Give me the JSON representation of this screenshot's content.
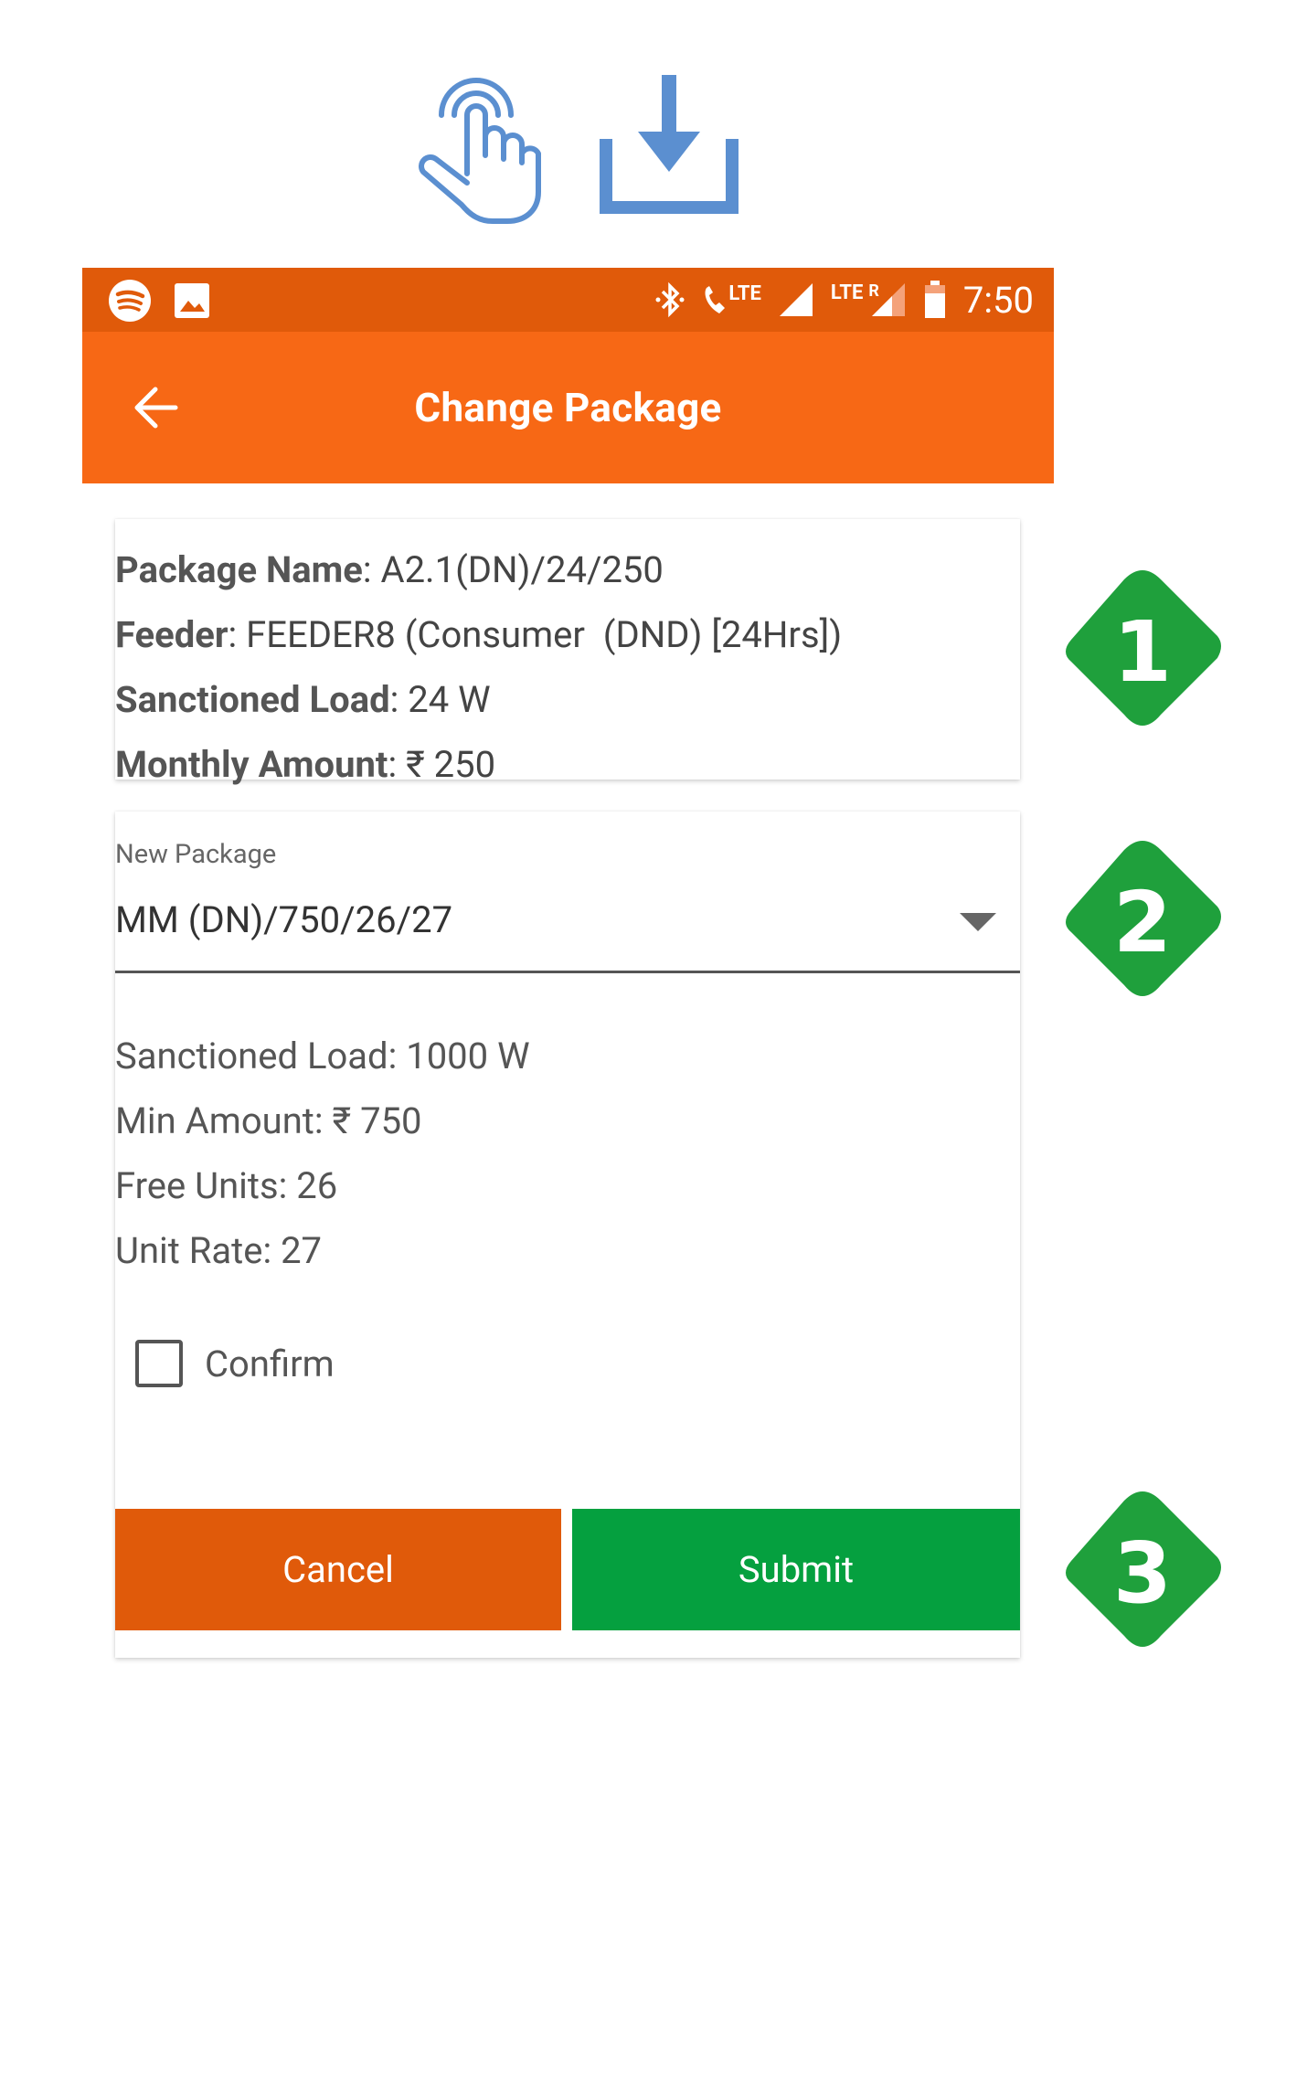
{
  "header_icons": [
    "touch-icon",
    "download-icon"
  ],
  "status_bar": {
    "time": "7:50",
    "lte1": "LTE",
    "lte2": "LTE",
    "roaming": "R"
  },
  "app_bar": {
    "title": "Change Package"
  },
  "current_package": {
    "package_name_label": "Package Name",
    "package_name_value": ": A2.1(DN)/24/250",
    "feeder_label": "Feeder",
    "feeder_value": ": FEEDER8 (Consumer  (DND) [24Hrs])",
    "sanctioned_load_label": "Sanctioned Load",
    "sanctioned_load_value": ": 24 W",
    "monthly_amount_label": "Monthly Amount",
    "monthly_amount_value": ": ₹ 250"
  },
  "new_package": {
    "label": "New Package",
    "selected": "MM (DN)/750/26/27",
    "sanctioned_load": "Sanctioned Load: 1000 W",
    "min_amount": "Min Amount: ₹ 750",
    "free_units": "Free Units: 26",
    "unit_rate": "Unit Rate: 27",
    "confirm_label": "Confirm",
    "confirm_checked": false
  },
  "buttons": {
    "cancel": "Cancel",
    "submit": "Submit"
  },
  "steps": [
    "1",
    "2",
    "3"
  ],
  "colors": {
    "status_bar": "#e05a0a",
    "app_bar": "#f76815",
    "cancel": "#e05a0a",
    "submit": "#05a03f",
    "step_badge": "#1fa03c",
    "top_icons": "#5b8fd0"
  }
}
